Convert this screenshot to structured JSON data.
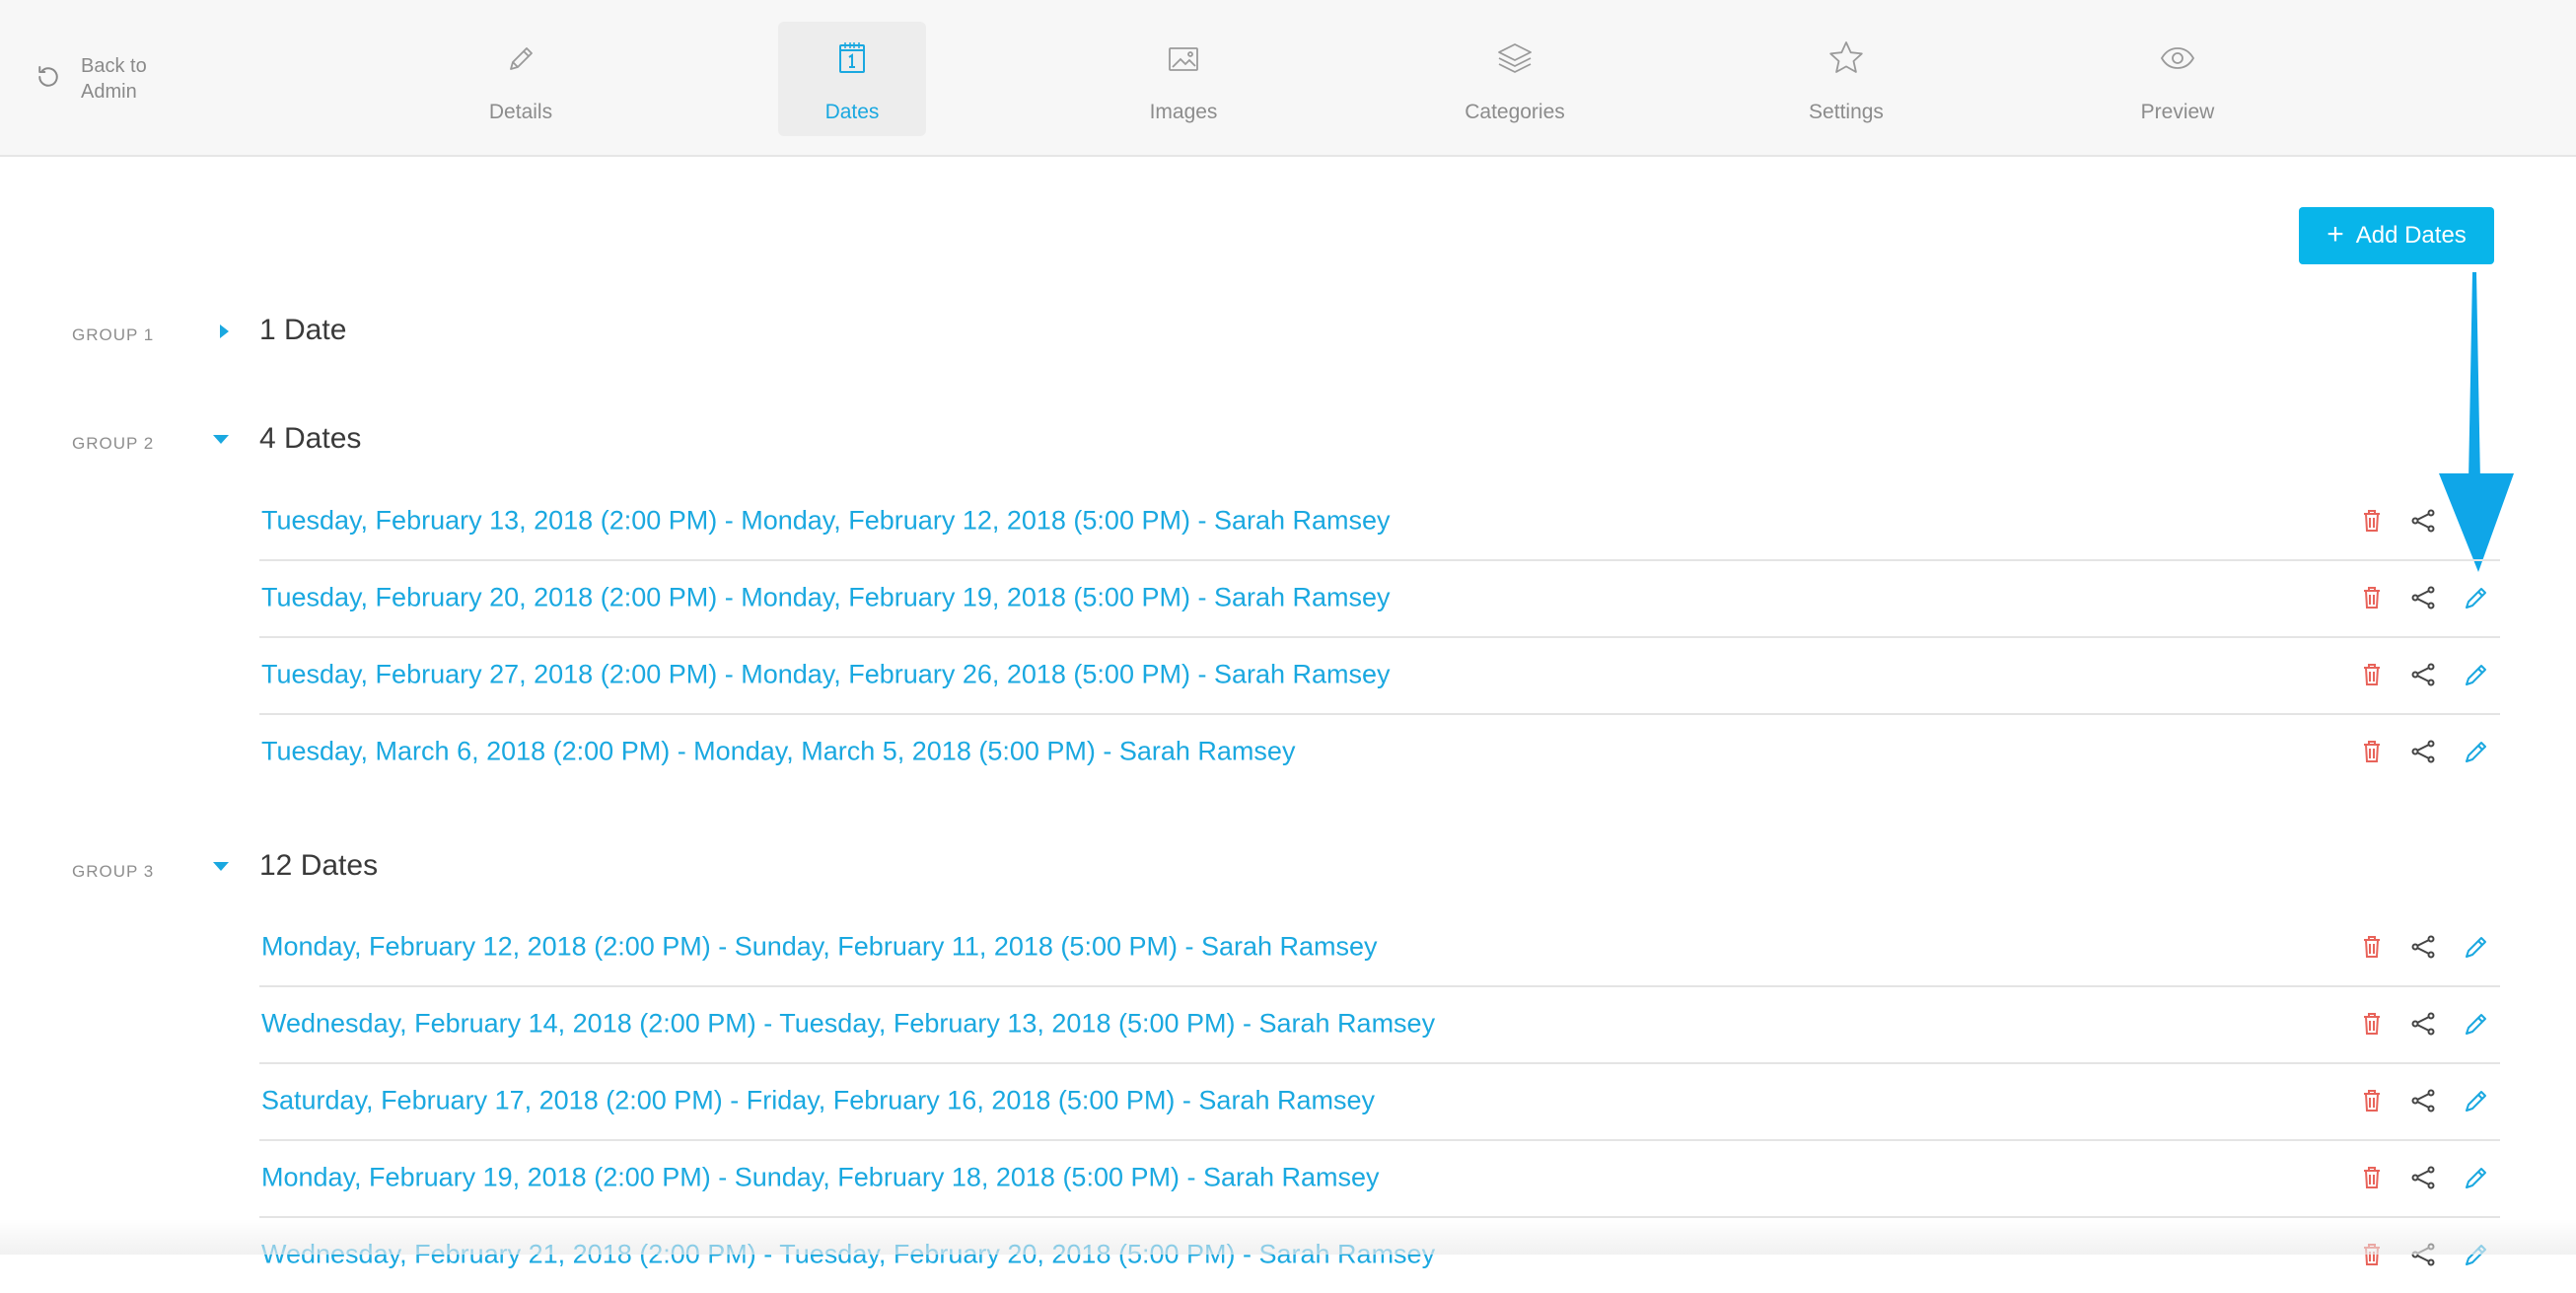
{
  "nav": {
    "back_label": "Back to\nAdmin",
    "tabs": [
      {
        "label": "Details",
        "icon": "pencil-icon"
      },
      {
        "label": "Dates",
        "icon": "calendar-icon"
      },
      {
        "label": "Images",
        "icon": "image-icon"
      },
      {
        "label": "Categories",
        "icon": "layers-icon"
      },
      {
        "label": "Settings",
        "icon": "star-icon"
      },
      {
        "label": "Preview",
        "icon": "eye-icon"
      }
    ],
    "active_tab": "Dates"
  },
  "add_button": {
    "label": "Add Dates"
  },
  "colors": {
    "accent": "#1aa8e0",
    "button": "#08b5ea",
    "delete": "#e8635a"
  },
  "groups": [
    {
      "label": "GROUP 1",
      "title": "1 Date",
      "expanded": false,
      "dates": []
    },
    {
      "label": "GROUP 2",
      "title": "4 Dates",
      "expanded": true,
      "dates": [
        "Tuesday, February 13, 2018 (2:00 PM) - Monday, February 12, 2018 (5:00 PM) - Sarah Ramsey",
        "Tuesday, February 20, 2018 (2:00 PM) - Monday, February 19, 2018 (5:00 PM) - Sarah Ramsey",
        "Tuesday, February 27, 2018 (2:00 PM) - Monday, February 26, 2018 (5:00 PM) - Sarah Ramsey",
        "Tuesday, March 6, 2018 (2:00 PM) - Monday, March 5, 2018 (5:00 PM) - Sarah Ramsey"
      ]
    },
    {
      "label": "GROUP 3",
      "title": "12 Dates",
      "expanded": true,
      "dates": [
        "Monday, February 12, 2018 (2:00 PM) - Sunday, February 11, 2018 (5:00 PM) - Sarah Ramsey",
        "Wednesday, February 14, 2018 (2:00 PM) - Tuesday, February 13, 2018 (5:00 PM) - Sarah Ramsey",
        "Saturday, February 17, 2018 (2:00 PM) - Friday, February 16, 2018 (5:00 PM) - Sarah Ramsey",
        "Monday, February 19, 2018 (2:00 PM) - Sunday, February 18, 2018 (5:00 PM) - Sarah Ramsey",
        "Wednesday, February 21, 2018 (2:00 PM) - Tuesday, February 20, 2018 (5:00 PM) - Sarah Ramsey"
      ]
    }
  ]
}
